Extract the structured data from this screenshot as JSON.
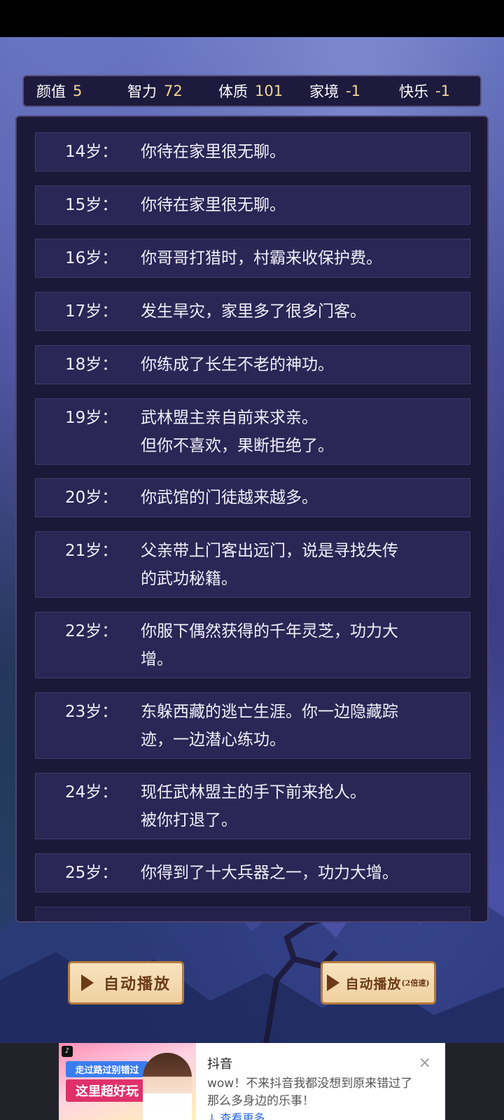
{
  "stats": [
    {
      "label": "颜值",
      "value": "5"
    },
    {
      "label": "智力",
      "value": "72"
    },
    {
      "label": "体质",
      "value": "101"
    },
    {
      "label": "家境",
      "value": "-1"
    },
    {
      "label": "快乐",
      "value": "-1"
    }
  ],
  "events": [
    {
      "age": "14岁：",
      "text": "你待在家里很无聊。"
    },
    {
      "age": "15岁：",
      "text": "你待在家里很无聊。"
    },
    {
      "age": "16岁：",
      "text": "你哥哥打猎时，村霸来收保护费。"
    },
    {
      "age": "17岁：",
      "text": "发生旱灾，家里多了很多门客。"
    },
    {
      "age": "18岁：",
      "text": "你练成了长生不老的神功。"
    },
    {
      "age": "19岁：",
      "text": "武林盟主亲自前来求亲。",
      "text2": "但你不喜欢，果断拒绝了。"
    },
    {
      "age": "20岁：",
      "text": "你武馆的门徒越来越多。"
    },
    {
      "age": "21岁：",
      "text": "父亲带上门客出远门，说是寻找失传",
      "text2": "的武功秘籍。"
    },
    {
      "age": "22岁：",
      "text": "你服下偶然获得的千年灵芝，功力大",
      "text2": "增。"
    },
    {
      "age": "23岁：",
      "text": "东躲西藏的逃亡生涯。你一边隐藏踪",
      "text2": "迹，一边潜心练功。"
    },
    {
      "age": "24岁：",
      "text": "现任武林盟主的手下前来抢人。",
      "text2": "被你打退了。"
    },
    {
      "age": "25岁：",
      "text": "你得到了十大兵器之一，功力大增。"
    }
  ],
  "buttons": {
    "autoplay": "自动播放",
    "autoplay2x": "自动播放",
    "autoplay2x_suffix": "(2倍速)"
  },
  "ad": {
    "title": "抖音",
    "desc": "wow！不来抖音我都没想到原来错过了那么多身边的乐事！",
    "more": "查看更多",
    "banner1": "走过路过别错过",
    "banner2": "这里超好玩",
    "close": "×"
  },
  "colors": {
    "stat_value": "#f0d890",
    "row_bg": "#2a2655",
    "button_bg": "#f3dbb0",
    "button_text": "#6b3a17"
  }
}
